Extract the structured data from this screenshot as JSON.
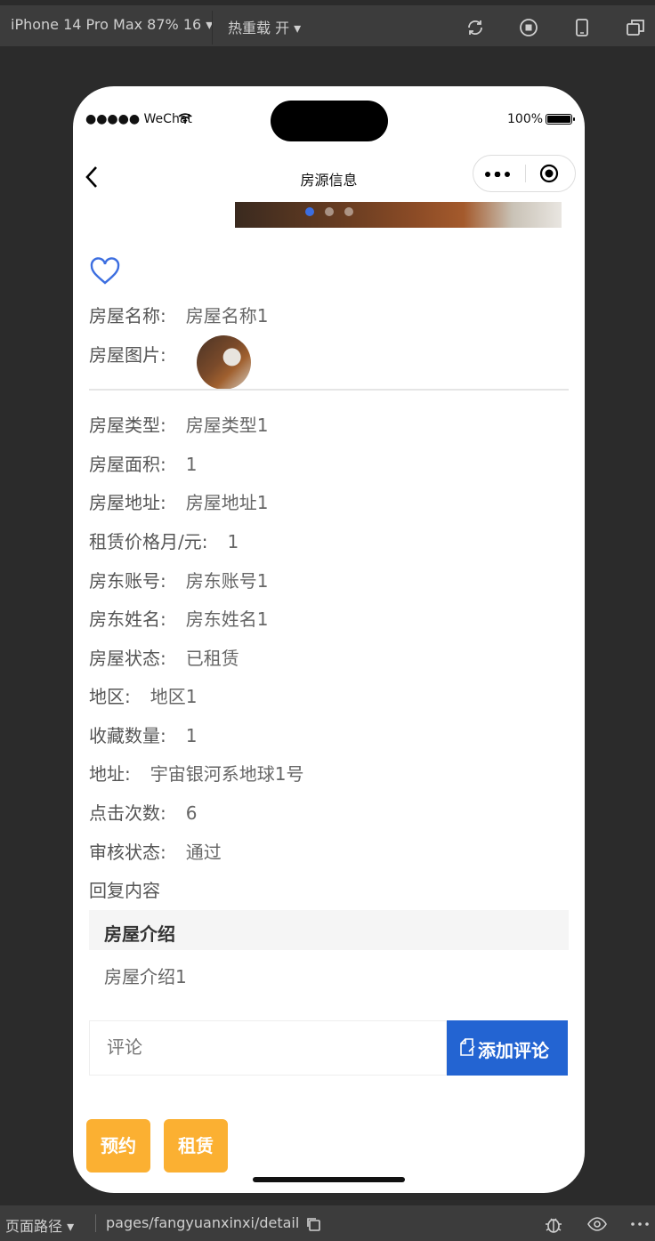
{
  "devtools": {
    "device": "iPhone 14 Pro Max 87% 16 ▾",
    "hot_reload": "热重载 开 ▾",
    "path_label": "页面路径 ▾",
    "path": "pages/fangyuanxinxi/detail"
  },
  "status_bar": {
    "carrier": "●●●●● WeChat",
    "battery": "100%"
  },
  "nav": {
    "title": "房源信息"
  },
  "banner": {
    "slide_count": 3,
    "active_index": 0
  },
  "fields": [
    {
      "label": "房屋名称:",
      "value": "房屋名称1"
    },
    {
      "label": "房屋图片:",
      "value": ""
    },
    {
      "label": "房屋类型:",
      "value": "房屋类型1"
    },
    {
      "label": "房屋面积:",
      "value": "1"
    },
    {
      "label": "房屋地址:",
      "value": "房屋地址1"
    },
    {
      "label": "租赁价格月/元:",
      "value": "1"
    },
    {
      "label": "房东账号:",
      "value": "房东账号1"
    },
    {
      "label": "房东姓名:",
      "value": "房东姓名1"
    },
    {
      "label": "房屋状态:",
      "value": "已租赁"
    },
    {
      "label": "地区:",
      "value": "地区1"
    },
    {
      "label": "收藏数量:",
      "value": "1"
    },
    {
      "label": "地址:",
      "value": "宇宙银河系地球1号"
    },
    {
      "label": "点击次数:",
      "value": "6"
    },
    {
      "label": "审核状态:",
      "value": "通过"
    },
    {
      "label": "回复内容",
      "value": ""
    }
  ],
  "intro": {
    "heading": "房屋介绍",
    "body": "房屋介绍1"
  },
  "comment": {
    "placeholder": "评论",
    "button": "添加评论"
  },
  "actions": {
    "reserve": "预约",
    "rent": "租赁"
  },
  "colors": {
    "accent": "#2364d2",
    "action": "#fbb032",
    "heart": "#3c6ee0"
  }
}
